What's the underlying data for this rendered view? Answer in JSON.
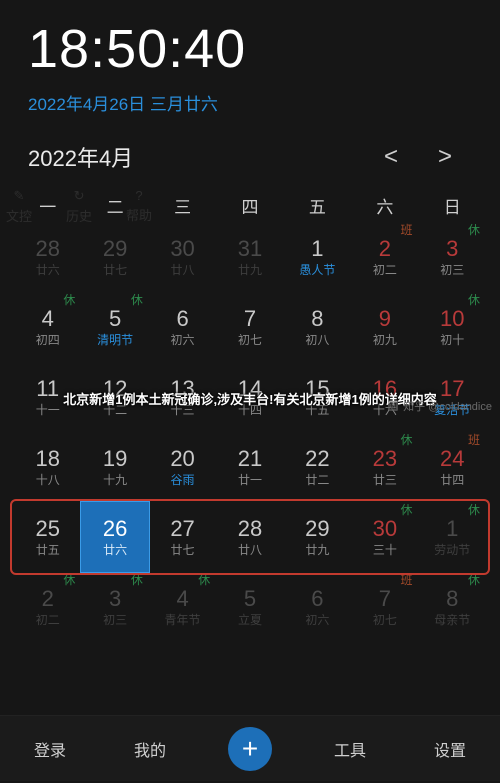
{
  "clock": "18:50:40",
  "date_line": "2022年4月26日 三月廿六",
  "month_label": "2022年4月",
  "nav": {
    "prev": "<",
    "next": ">"
  },
  "weekdays": [
    "一",
    "二",
    "三",
    "四",
    "五",
    "六",
    "日"
  ],
  "ghost": [
    "文控",
    "历史",
    "帮助"
  ],
  "overlay": "北京新增1例本土新冠确诊,涉及丰台!有关北京新增1例的详细内容",
  "watermark": "知乎 @coldandice",
  "bottom": {
    "login": "登录",
    "mine": "我的",
    "add": "+",
    "tools": "工具",
    "settings": "设置"
  },
  "cells": [
    {
      "n": "28",
      "s": "廿六",
      "cls": "out"
    },
    {
      "n": "29",
      "s": "廿七",
      "cls": "out"
    },
    {
      "n": "30",
      "s": "廿八",
      "cls": "out"
    },
    {
      "n": "31",
      "s": "廿九",
      "cls": "out"
    },
    {
      "n": "1",
      "s": "愚人节",
      "cls": "wk blue"
    },
    {
      "n": "2",
      "s": "初二",
      "cls": "we",
      "corner": "班",
      "ctype": "work"
    },
    {
      "n": "3",
      "s": "初三",
      "cls": "we",
      "corner": "休",
      "ctype": "rest"
    },
    {
      "n": "4",
      "s": "初四",
      "cls": "wk",
      "corner": "休",
      "ctype": "rest"
    },
    {
      "n": "5",
      "s": "清明节",
      "cls": "wk blue",
      "corner": "休",
      "ctype": "rest"
    },
    {
      "n": "6",
      "s": "初六",
      "cls": "wk"
    },
    {
      "n": "7",
      "s": "初七",
      "cls": "wk"
    },
    {
      "n": "8",
      "s": "初八",
      "cls": "wk"
    },
    {
      "n": "9",
      "s": "初九",
      "cls": "we"
    },
    {
      "n": "10",
      "s": "初十",
      "cls": "we",
      "corner": "休",
      "ctype": "rest"
    },
    {
      "n": "11",
      "s": "十一",
      "cls": "wk"
    },
    {
      "n": "12",
      "s": "十二",
      "cls": "wk"
    },
    {
      "n": "13",
      "s": "十三",
      "cls": "wk"
    },
    {
      "n": "14",
      "s": "十四",
      "cls": "wk"
    },
    {
      "n": "15",
      "s": "十五",
      "cls": "wk"
    },
    {
      "n": "16",
      "s": "十六",
      "cls": "we"
    },
    {
      "n": "17",
      "s": "复活节",
      "cls": "we blue"
    },
    {
      "n": "18",
      "s": "十八",
      "cls": "wk"
    },
    {
      "n": "19",
      "s": "十九",
      "cls": "wk"
    },
    {
      "n": "20",
      "s": "谷雨",
      "cls": "wk blue"
    },
    {
      "n": "21",
      "s": "廿一",
      "cls": "wk"
    },
    {
      "n": "22",
      "s": "廿二",
      "cls": "wk"
    },
    {
      "n": "23",
      "s": "廿三",
      "cls": "we",
      "corner": "休",
      "ctype": "rest"
    },
    {
      "n": "24",
      "s": "廿四",
      "cls": "we",
      "corner": "班",
      "ctype": "work"
    },
    {
      "n": "25",
      "s": "廿五",
      "cls": "wk"
    },
    {
      "n": "26",
      "s": "廿六",
      "cls": "wk today"
    },
    {
      "n": "27",
      "s": "廿七",
      "cls": "wk"
    },
    {
      "n": "28",
      "s": "廿八",
      "cls": "wk"
    },
    {
      "n": "29",
      "s": "廿九",
      "cls": "wk"
    },
    {
      "n": "30",
      "s": "三十",
      "cls": "we",
      "corner": "休",
      "ctype": "rest"
    },
    {
      "n": "1",
      "s": "劳动节",
      "cls": "out",
      "corner": "休",
      "ctype": "rest"
    },
    {
      "n": "2",
      "s": "初二",
      "cls": "out",
      "corner": "休",
      "ctype": "rest"
    },
    {
      "n": "3",
      "s": "初三",
      "cls": "out",
      "corner": "休",
      "ctype": "rest"
    },
    {
      "n": "4",
      "s": "青年节",
      "cls": "out",
      "corner": "休",
      "ctype": "rest"
    },
    {
      "n": "5",
      "s": "立夏",
      "cls": "out"
    },
    {
      "n": "6",
      "s": "初六",
      "cls": "out"
    },
    {
      "n": "7",
      "s": "初七",
      "cls": "out",
      "corner": "班",
      "ctype": "work"
    },
    {
      "n": "8",
      "s": "母亲节",
      "cls": "out",
      "corner": "休",
      "ctype": "rest"
    }
  ]
}
